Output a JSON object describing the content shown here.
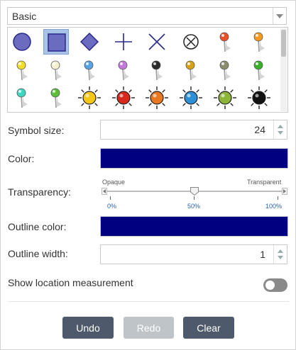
{
  "symbol_set": {
    "selected": "Basic"
  },
  "symbols": [
    {
      "name": "circle-symbol",
      "kind": "circle"
    },
    {
      "name": "square-symbol",
      "kind": "square",
      "selected": true
    },
    {
      "name": "diamond-symbol",
      "kind": "diamond"
    },
    {
      "name": "cross-symbol",
      "kind": "cross"
    },
    {
      "name": "x-symbol",
      "kind": "x"
    },
    {
      "name": "circle-x-symbol",
      "kind": "circlex"
    },
    {
      "name": "red-pushpin-symbol",
      "kind": "pin",
      "color": "#e8502a"
    },
    {
      "name": "orange-pushpin-symbol",
      "kind": "pin",
      "color": "#f29a1e"
    },
    {
      "name": "yellow-pushpin-symbol",
      "kind": "pin",
      "color": "#f3dd2b"
    },
    {
      "name": "white-pushpin-symbol",
      "kind": "pin",
      "color": "#f4f1d0"
    },
    {
      "name": "blue-pushpin-symbol",
      "kind": "pin",
      "color": "#5aa3e0"
    },
    {
      "name": "purple-pushpin-symbol",
      "kind": "pin",
      "color": "#c27ad8"
    },
    {
      "name": "black-pushpin-symbol",
      "kind": "pin",
      "color": "#2c2c2c"
    },
    {
      "name": "gold-pushpin-symbol",
      "kind": "pin",
      "color": "#d4a318"
    },
    {
      "name": "gray-pushpin-symbol",
      "kind": "pin",
      "color": "#8c8c6e"
    },
    {
      "name": "green-pushpin-symbol",
      "kind": "pin",
      "color": "#3cae2e"
    },
    {
      "name": "teal-pushpin-symbol",
      "kind": "pin",
      "color": "#3fd6c0"
    },
    {
      "name": "lime-pushpin-symbol",
      "kind": "pin",
      "color": "#5bbf3a"
    },
    {
      "name": "yellow-burst-symbol",
      "kind": "burst",
      "color": "#f5c518"
    },
    {
      "name": "red-burst-symbol",
      "kind": "burst",
      "color": "#d8281b"
    },
    {
      "name": "orange-burst-symbol",
      "kind": "burst",
      "color": "#e8781f"
    },
    {
      "name": "blue-burst-symbol",
      "kind": "burst",
      "color": "#2e8fd6"
    },
    {
      "name": "green-burst-symbol",
      "kind": "burst",
      "color": "#8cb53a"
    },
    {
      "name": "black-burst-symbol",
      "kind": "burst",
      "color": "#111111"
    }
  ],
  "symbol_size": {
    "label": "Symbol size:",
    "value": "24"
  },
  "color": {
    "label": "Color:",
    "value": "#000080"
  },
  "transparency": {
    "label": "Transparency:",
    "left_label": "Opaque",
    "right_label": "Transparent",
    "value": 0.5,
    "ticks": [
      "0%",
      "50%",
      "100%"
    ]
  },
  "outline_color": {
    "label": "Outline color:",
    "value": "#000080"
  },
  "outline_width": {
    "label": "Outline width:",
    "value": "1"
  },
  "show_location": {
    "label": "Show location measurement",
    "enabled": false
  },
  "buttons": {
    "undo": "Undo",
    "redo": "Redo",
    "clear": "Clear"
  },
  "colors": {
    "button": "#4e5a6b",
    "button_disabled": "#bfc4c8",
    "fill": "#000080",
    "symbol_fill": "#6b6bbf",
    "symbol_stroke": "#2a2a8a"
  }
}
